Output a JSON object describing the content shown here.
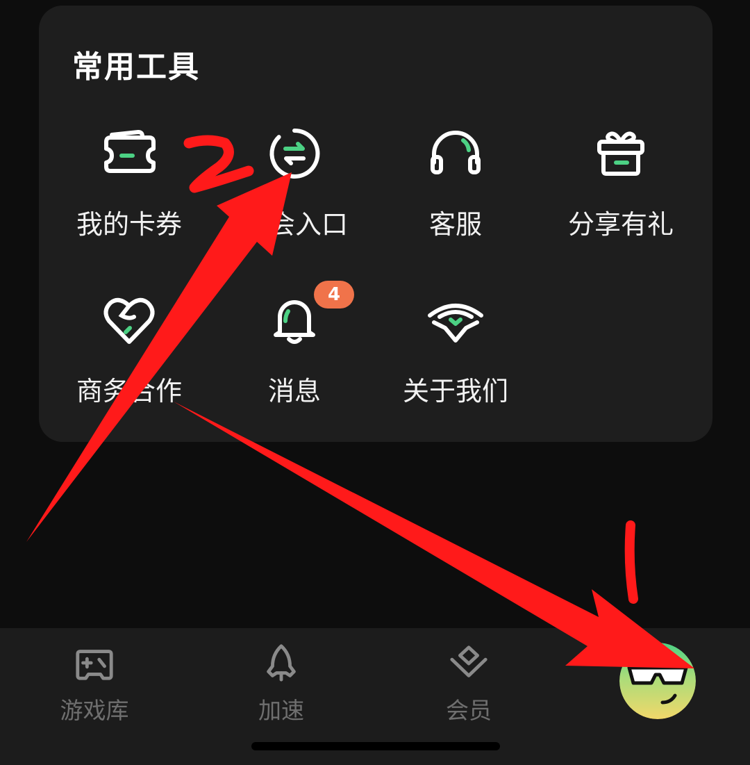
{
  "tools_card": {
    "title": "常用工具",
    "items": [
      {
        "label": "我的卡券",
        "icon": "coupon-ticket-icon"
      },
      {
        "label": "兑换码入口",
        "visible_label": "会入口",
        "icon": "exchange-arrows-icon"
      },
      {
        "label": "客服",
        "icon": "headset-icon"
      },
      {
        "label": "分享有礼",
        "icon": "gift-box-icon"
      },
      {
        "label": "商务合作",
        "icon": "heart-handshake-icon"
      },
      {
        "label": "消息",
        "icon": "bell-icon",
        "badge": "4"
      },
      {
        "label": "关于我们",
        "icon": "wings-heart-logo-icon"
      }
    ]
  },
  "tab_bar": {
    "tabs": [
      {
        "label": "游戏库",
        "icon": "gamepad-icon"
      },
      {
        "label": "加速",
        "icon": "rocket-icon"
      },
      {
        "label": "会员",
        "icon": "diamond-heart-icon"
      }
    ],
    "profile_avatar": {
      "icon": "sunglasses-smiley-avatar-icon"
    }
  },
  "annotations": {
    "mark_1": "1",
    "mark_2": "2",
    "color": "#ff1a1a"
  },
  "colors": {
    "accent_green": "#4cd184",
    "badge_orange": "#f0734a",
    "card_bg": "#1e1e1e",
    "page_bg": "#0d0d0d"
  }
}
